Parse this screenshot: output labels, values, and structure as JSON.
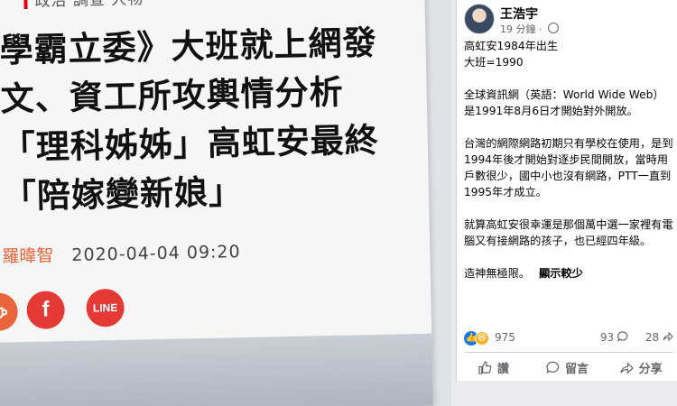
{
  "article": {
    "category": "政治 調查 人物",
    "headline_lines": [
      "學霸立委》大班就上網發",
      "文、資工所攻輿情分析",
      "「理科姊姊」高虹安最終",
      "「陪嫁變新娘」"
    ],
    "author": "羅暐智",
    "date": "2020-04-04 09:20",
    "share_buttons": [
      {
        "icon": "cup-icon",
        "label": ""
      },
      {
        "icon": "facebook-icon",
        "label": "f"
      },
      {
        "icon": "line-icon",
        "label": "LINE"
      }
    ],
    "colors": {
      "accent": "#e8643a",
      "share_red": "#e53935",
      "category_bar": "#e60012"
    }
  },
  "post": {
    "author_name": "王浩宇",
    "time": "19 分鐘",
    "time_separator": "·",
    "paragraphs": [
      [
        "高虹安1984年出生",
        "大班=1990"
      ],
      [
        "全球資訊網（英語：World Wide Web）是1991年8月6日才開始對外開放。"
      ],
      [
        "台灣的網際網路初期只有學校在使用，是到1994年後才開始對逐步民間開放，當時用戶數很少，國中小也沒有網路，PTT一直到1995年才成立。"
      ],
      [
        "就算高虹安很幸運是那個萬中選一家裡有電腦又有接網路的孩子，也已經四年級。"
      ],
      [
        "造神無極限。"
      ]
    ],
    "see_less": "顯示較少",
    "reaction_count": "975",
    "comment_count": "93",
    "share_count": "28",
    "actions": {
      "like": "讚",
      "comment": "留言",
      "share": "分享"
    },
    "colors": {
      "like_blue": "#1877f2",
      "haha_yellow": "#f7b125",
      "muted": "#65676b"
    }
  }
}
